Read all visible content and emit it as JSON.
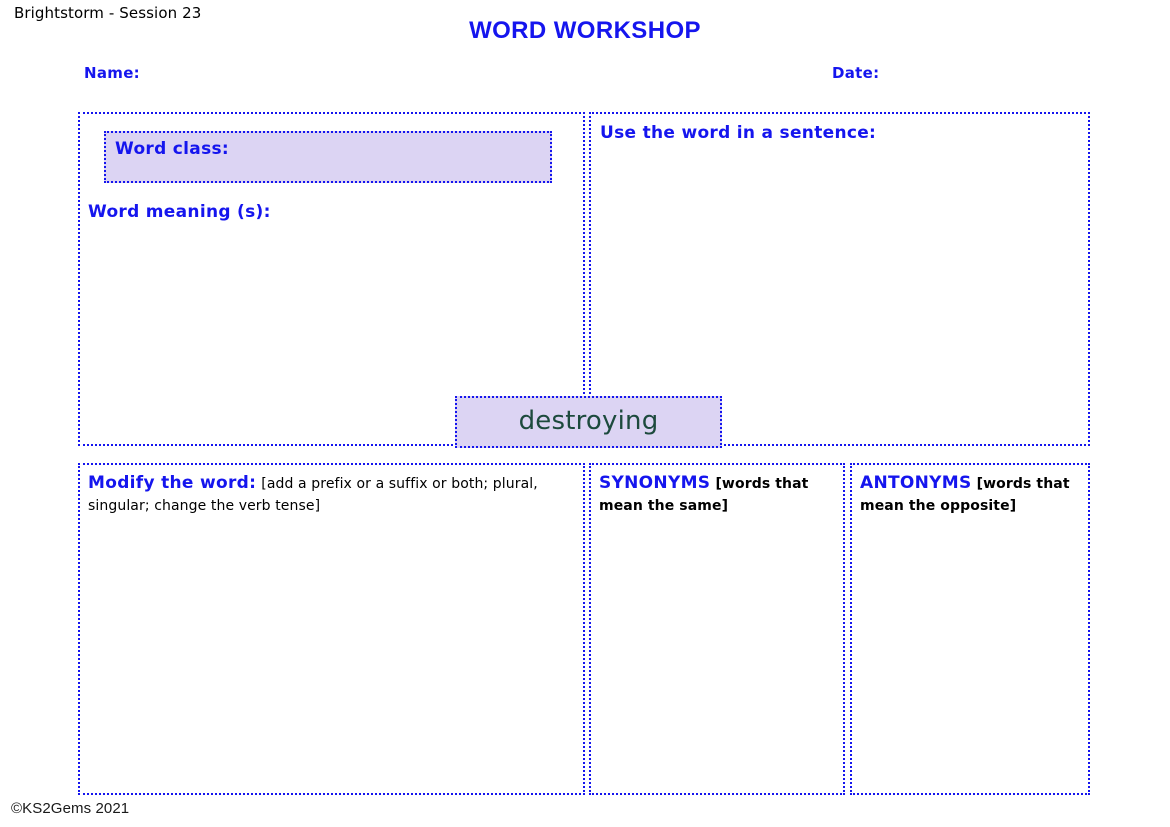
{
  "header": {
    "session_label": "Brightstorm - Session 23",
    "title": "WORD WORKSHOP",
    "name_label": "Name:",
    "date_label": "Date:"
  },
  "focus_word": {
    "text": "destroying"
  },
  "panels": {
    "word_class": {
      "label": "Word class:",
      "value": ""
    },
    "word_meaning": {
      "label": "Word meaning (s):",
      "value": ""
    },
    "sentence": {
      "label": "Use the word in a sentence:",
      "value": ""
    },
    "modify": {
      "label": "Modify the word:",
      "note": "[add a prefix or a suffix or both; plural, singular; change the verb tense]",
      "value": ""
    },
    "synonyms": {
      "label": "SYNONYMS",
      "note": "[words that mean the same]",
      "value": ""
    },
    "antonyms": {
      "label": "ANTONYMS",
      "note": "[words that mean the opposite]",
      "value": ""
    }
  },
  "footer": {
    "copyright": "©KS2Gems 2021"
  },
  "colors": {
    "accent_blue": "#1515EE",
    "panel_fill_lavender": "#DCD4F3",
    "focus_word_text": "#1D4A3D",
    "body_text": "#000000",
    "page_background": "#FFFFFF"
  }
}
